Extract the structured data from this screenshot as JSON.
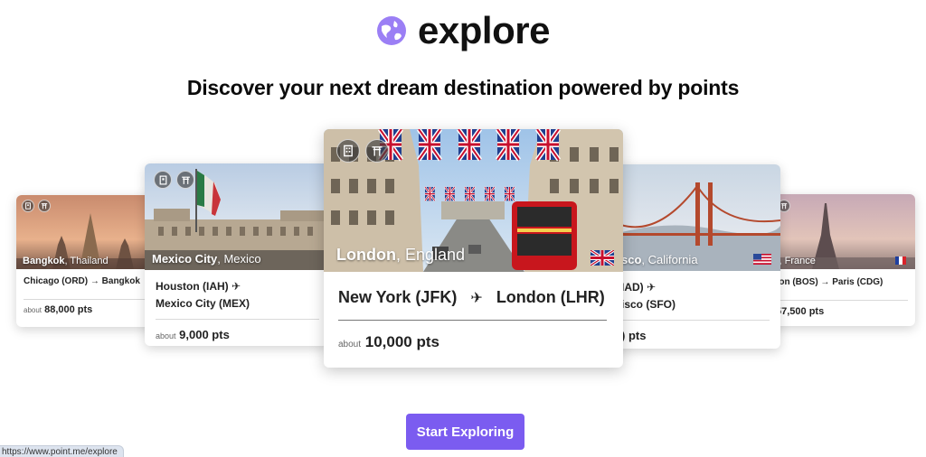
{
  "brand": {
    "name": "explore",
    "logo_color": "#9b7ff5"
  },
  "headline": "Discover your next dream destination powered by points",
  "cards": [
    {
      "city": "Bangkok",
      "country": ", Thailand",
      "route_line1": "Chicago (ORD) → Bangkok",
      "about_label": "about",
      "points": "88,000 pts",
      "icons": [
        "hotel-icon",
        "torii-gate-icon"
      ]
    },
    {
      "city": "Mexico City",
      "country": ", Mexico",
      "route_line1": "Houston (IAH) ✈",
      "route_line2": "Mexico City (MEX)",
      "about_label": "about",
      "points": "9,000 pts",
      "icons": [
        "hotel-icon",
        "torii-gate-icon"
      ]
    },
    {
      "city": "London",
      "country": ", England",
      "origin": "New York (JFK)",
      "destination": "London (LHR)",
      "about_label": "about",
      "points": "10,000 pts",
      "icons": [
        "hotel-icon",
        "torii-gate-icon"
      ],
      "flag": "uk-flag-icon"
    },
    {
      "city": "sco",
      "country": ", California",
      "route_line1": "IAD) ✈",
      "route_line2": "isco (SFO)",
      "points": ") pts",
      "flag": "us-flag-icon"
    },
    {
      "city": "",
      "country": "s, France",
      "route_line1": "ton (BOS) → Paris (CDG)",
      "points": "57,500 pts",
      "icons": [
        "torii-gate-icon"
      ],
      "flag": "france-flag-icon"
    }
  ],
  "cta": {
    "label": "Start Exploring",
    "color": "#7b5cf0"
  },
  "status_bar": {
    "url": "https://www.point.me/explore"
  }
}
